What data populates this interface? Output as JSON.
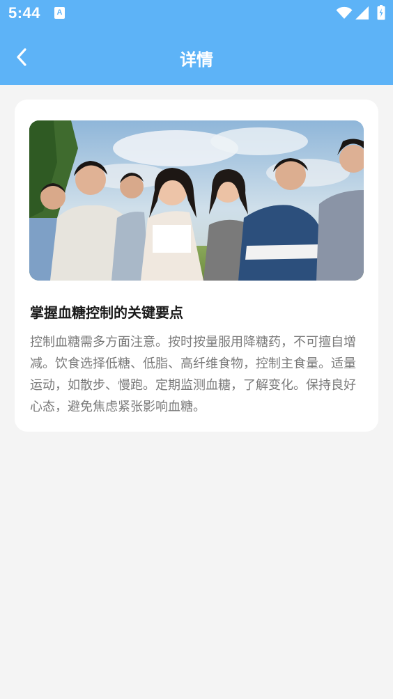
{
  "status_bar": {
    "time": "5:44",
    "notification_icon": "a-icon",
    "icons": [
      "wifi-icon",
      "signal-icon",
      "battery-icon"
    ]
  },
  "nav": {
    "title": "详情",
    "back_icon": "chevron-left-icon"
  },
  "article": {
    "title": "掌握血糖控制的关键要点",
    "body": "控制血糖需多方面注意。按时按量服用降糖药，不可擅自增减。饮食选择低糖、低脂、高纤维食物，控制主食量。适量运动，如散步、慢跑。定期监测血糖，了解变化。保持良好心态，避免焦虑紧张影响血糖。"
  },
  "colors": {
    "header": "#5db3f7",
    "background": "#f4f4f4",
    "card": "#ffffff",
    "title_text": "#1a1a1a",
    "body_text": "#7a7a7a"
  }
}
